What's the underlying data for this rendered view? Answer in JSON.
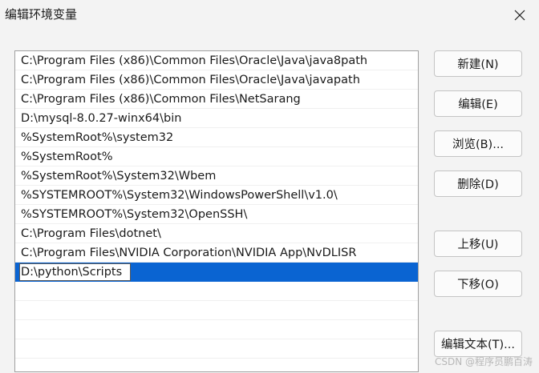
{
  "window": {
    "title": "编辑环境变量",
    "close_icon": "close-icon"
  },
  "paths": [
    "C:\\Program Files (x86)\\Common Files\\Oracle\\Java\\java8path",
    "C:\\Program Files (x86)\\Common Files\\Oracle\\Java\\javapath",
    "C:\\Program Files (x86)\\Common Files\\NetSarang",
    "D:\\mysql-8.0.27-winx64\\bin",
    "%SystemRoot%\\system32",
    "%SystemRoot%",
    "%SystemRoot%\\System32\\Wbem",
    "%SYSTEMROOT%\\System32\\WindowsPowerShell\\v1.0\\",
    "%SYSTEMROOT%\\System32\\OpenSSH\\",
    "C:\\Program Files\\dotnet\\",
    "C:\\Program Files\\NVIDIA Corporation\\NVIDIA App\\NvDLISR"
  ],
  "editing": {
    "value": "D:\\python\\Scripts"
  },
  "buttons": {
    "new": "新建(N)",
    "edit": "编辑(E)",
    "browse": "浏览(B)...",
    "delete": "删除(D)",
    "move_up": "上移(U)",
    "move_down": "下移(O)",
    "edit_text": "编辑文本(T)..."
  },
  "watermark": "CSDN @程序员鹏百涛",
  "colors": {
    "selection": "#0a64d2",
    "background": "#f3f3f3"
  }
}
